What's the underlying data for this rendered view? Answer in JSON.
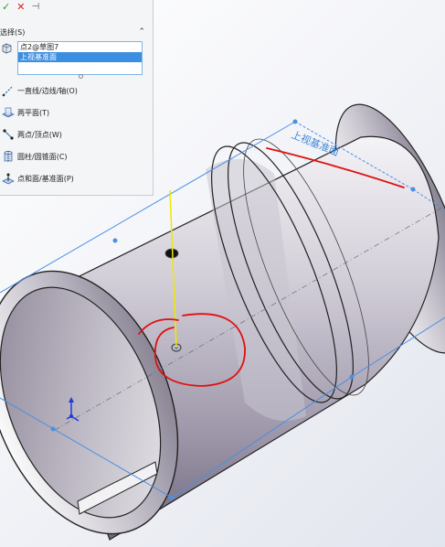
{
  "panel": {
    "ok_icon": "check-icon",
    "cancel_icon": "x-icon",
    "pin_icon": "pushpin-icon",
    "selection_title": "选择(S)",
    "collapse_icon": "chevron-up-icon",
    "selections": [
      "点2@草图7",
      "上视基准面",
      ""
    ],
    "selected_index": 1,
    "options": [
      {
        "label": "一直线/边线/轴(O)",
        "icon": "line-edge-axis-icon"
      },
      {
        "label": "两平面(T)",
        "icon": "two-planes-icon"
      },
      {
        "label": "两点/顶点(W)",
        "icon": "two-points-icon"
      },
      {
        "label": "圆柱/圆锥面(C)",
        "icon": "cylinder-cone-icon"
      },
      {
        "label": "点和面/基准面(P)",
        "icon": "point-plane-icon"
      }
    ]
  },
  "viewport": {
    "plane_label": "上视基准面",
    "colors": {
      "plane_edge": "#4a90e2",
      "axis_preview": "#f0e800",
      "annotation": "#e01010",
      "body_mid": "#b8b2c2",
      "body_dark": "#7b7488"
    }
  }
}
